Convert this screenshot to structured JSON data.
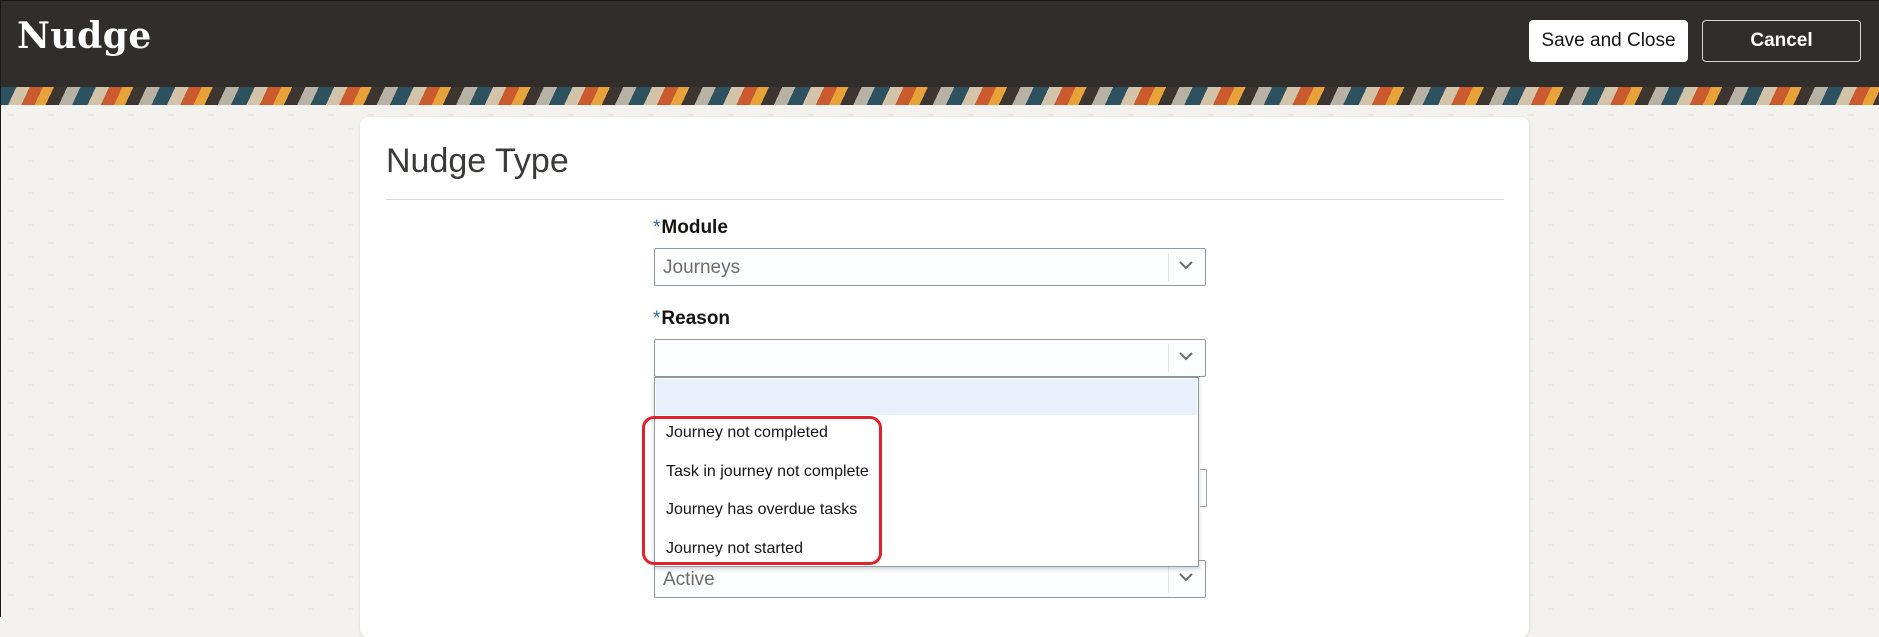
{
  "header": {
    "title": "Nudge",
    "save_close_label": "Save and Close",
    "cancel_label": "Cancel"
  },
  "card": {
    "title": "Nudge Type"
  },
  "fields": {
    "module": {
      "required_mark": "*",
      "label": "Module",
      "value": "Journeys"
    },
    "reason": {
      "required_mark": "*",
      "label": "Reason",
      "value": ""
    },
    "status": {
      "value": "Active"
    }
  },
  "reason_dropdown": {
    "options": [
      "",
      "Journey not completed",
      "Task in journey not complete",
      "Journey has overdue tasks",
      "Journey not started"
    ]
  },
  "colors": {
    "header_bg": "#312d2a",
    "highlight": "#e0202a",
    "required_mark": "#2f6fa6"
  },
  "icons": [
    "chevron-down-icon"
  ]
}
